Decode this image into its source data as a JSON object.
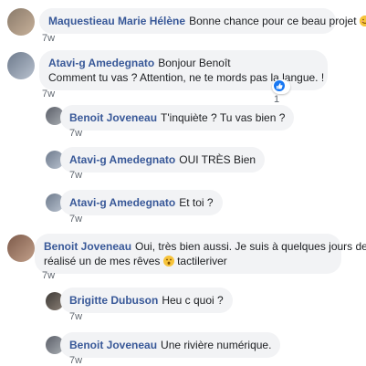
{
  "comments": [
    {
      "author": "Maquestieau Marie Hélène",
      "text": "Bonne chance pour ce beau projet",
      "emoji": "blush",
      "time": "7w"
    },
    {
      "author": "Atavi-g Amedegnato",
      "text": "Bonjour Benoît",
      "text2": "Comment tu vas ? Attention, ne te mords pas la langue. !",
      "time": "7w",
      "reaction_count": "1"
    },
    {
      "author": "Benoit Joveneau",
      "text": "T'inquiète ? Tu vas bien ?",
      "time": "7w"
    },
    {
      "author": "Atavi-g Amedegnato",
      "text": "OUI TRÈS Bien",
      "time": "7w"
    },
    {
      "author": "Atavi-g Amedegnato",
      "text": "Et toi ?",
      "time": "7w"
    },
    {
      "author": "Benoit Joveneau",
      "text": "Oui, très bien aussi. Je suis à quelques jours de",
      "text2_a": "réalisé un de mes rêves",
      "text2_b": "tactileriver",
      "emoji": "astonished",
      "time": "7w"
    },
    {
      "author": "Brigitte Dubuson",
      "text": "Heu c quoi ?",
      "time": "7w"
    },
    {
      "author": "Benoit Joveneau",
      "text": "Une rivière numérique.",
      "time": "7w"
    }
  ],
  "colors": {
    "author": "#385898",
    "bubble": "#f2f3f5",
    "like": "#1877f2"
  }
}
